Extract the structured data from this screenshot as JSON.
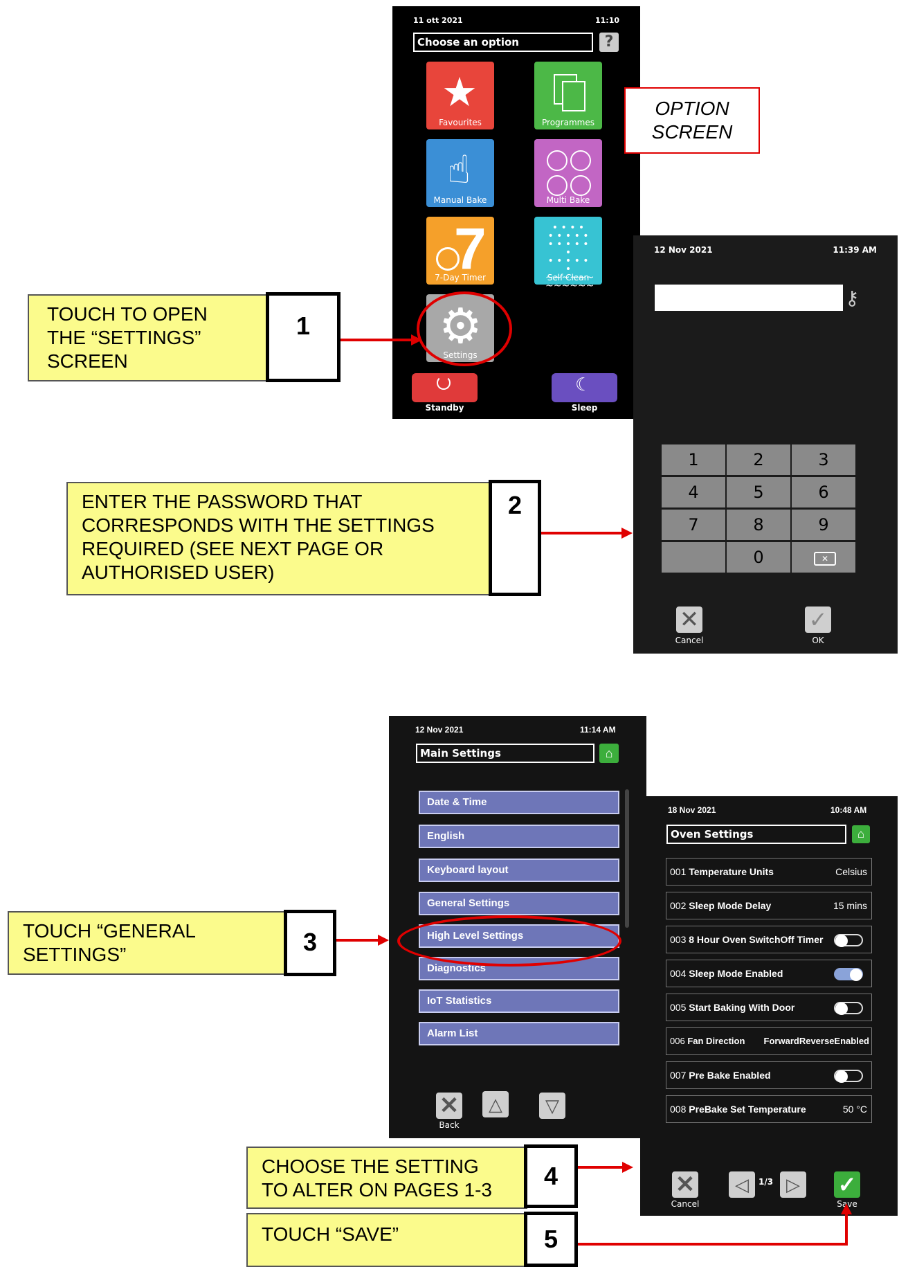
{
  "option_screen": {
    "date": "11 ott 2021",
    "time": "11:10",
    "prompt": "Choose an option",
    "tiles": [
      "Favourites",
      "Programmes",
      "Manual Bake",
      "Multi Bake",
      "7-Day Timer",
      "Self Clean",
      "Settings"
    ],
    "standby": "Standby",
    "sleep": "Sleep",
    "caption_line1": "OPTION",
    "caption_line2": "SCREEN"
  },
  "password_screen": {
    "date": "12 Nov 2021",
    "time": "11:39 AM",
    "keys": [
      "1",
      "2",
      "3",
      "4",
      "5",
      "6",
      "7",
      "8",
      "9",
      "",
      "0",
      ""
    ],
    "cancel": "Cancel",
    "ok": "OK"
  },
  "main_settings": {
    "date": "12 Nov 2021",
    "time": "11:14 AM",
    "title": "Main Settings",
    "items": [
      "Date & Time",
      "English",
      "Keyboard layout",
      "General Settings",
      "High Level Settings",
      "Diagnostics",
      "IoT Statistics",
      "Alarm List"
    ],
    "back": "Back"
  },
  "oven_settings": {
    "date": "18 Nov 2021",
    "time": "10:48 AM",
    "title": "Oven Settings",
    "rows": [
      {
        "code": "001",
        "label": "Temperature Units",
        "value": "Celsius"
      },
      {
        "code": "002",
        "label": "Sleep Mode Delay",
        "value": "15 mins"
      },
      {
        "code": "003",
        "label": "8 Hour Oven SwitchOff Timer",
        "toggle": "off"
      },
      {
        "code": "004",
        "label": "Sleep Mode Enabled",
        "toggle": "on"
      },
      {
        "code": "005",
        "label": "Start Baking With Door",
        "toggle": "off"
      },
      {
        "code": "006",
        "label": "Fan Direction",
        "value": "ForwardReverseEnabled"
      },
      {
        "code": "007",
        "label": "Pre Bake Enabled",
        "toggle": "off"
      },
      {
        "code": "008",
        "label": "PreBake Set Temperature",
        "value": "50 °C"
      }
    ],
    "page": "1/3",
    "cancel": "Cancel",
    "save": "Save"
  },
  "annotations": {
    "a1": [
      "TOUCH TO OPEN",
      "THE “SETTINGS”",
      "SCREEN"
    ],
    "a2": [
      "ENTER THE PASSWORD THAT",
      "CORRESPONDS WITH THE SETTINGS",
      "REQUIRED (SEE NEXT PAGE OR",
      "AUTHORISED USER)"
    ],
    "a3": [
      "TOUCH “GENERAL",
      "SETTINGS”"
    ],
    "a4": [
      "CHOOSE THE SETTING",
      "TO ALTER ON PAGES 1-3"
    ],
    "a5": [
      "TOUCH “SAVE”"
    ],
    "numbers": [
      "1",
      "2",
      "3",
      "4",
      "5"
    ]
  },
  "colors": {
    "annotation_bg": "#fbfb8c",
    "arrow": "#e00000",
    "menu_button": "#6e76b8",
    "home_green": "#3cae3c"
  }
}
